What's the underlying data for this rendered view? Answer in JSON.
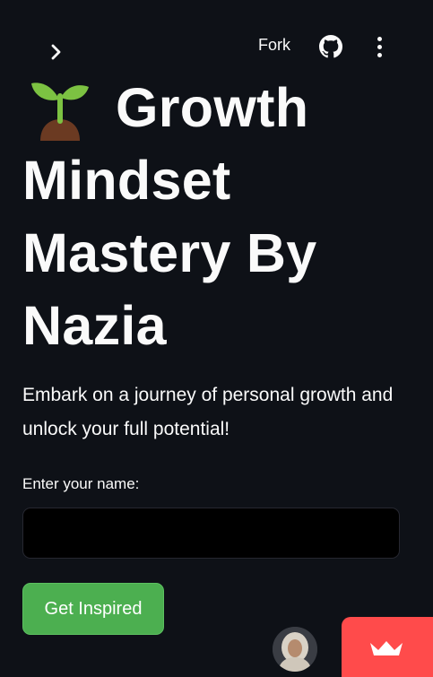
{
  "header": {
    "fork_label": "Fork"
  },
  "icons": {
    "expand": "chevron-right-icon",
    "github": "github-icon",
    "menu": "kebab-menu-icon",
    "title_emoji": "seedling-icon",
    "badge": "streamlit-crown-icon"
  },
  "main": {
    "title": "Growth Mindset Mastery By Nazia",
    "subtitle": "Embark on a journey of personal growth and unlock your full potential!",
    "name_label": "Enter your name:",
    "name_value": "",
    "button_label": "Get Inspired"
  },
  "colors": {
    "background": "#0e1117",
    "button": "#4caf50",
    "badge": "#ff4b4b"
  }
}
